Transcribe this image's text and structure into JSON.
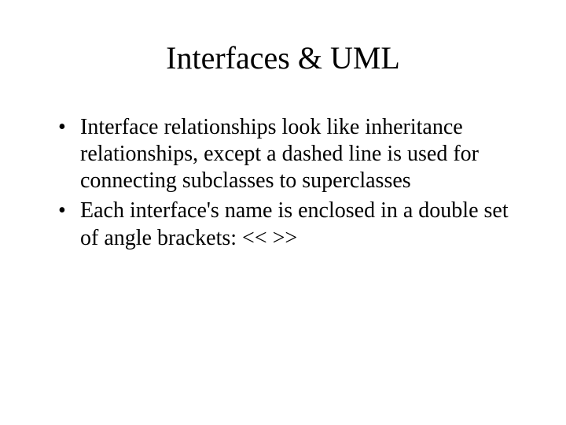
{
  "slide": {
    "title": "Interfaces & UML",
    "bullets": [
      "Interface relationships look like inheritance relationships, except a dashed line is used for connecting subclasses to superclasses",
      "Each interface's name is enclosed in a double set of angle brackets: << >>"
    ]
  }
}
